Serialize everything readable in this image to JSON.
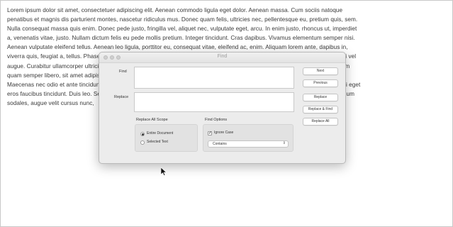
{
  "document": {
    "lines": [
      "Lorem ipsum dolor sit amet, consectetuer adipiscing elit. Aenean commodo ligula eget dolor. Aenean massa. Cum sociis natoque",
      "penatibus et magnis dis parturient montes, nascetur ridiculus mus. Donec quam felis, ultricies nec, pellentesque eu, pretium quis, sem.",
      "Nulla consequat massa quis enim. Donec pede justo, fringilla vel, aliquet nec, vulputate eget, arcu. In enim justo, rhoncus ut, imperdiet",
      "a, venenatis vitae, justo. Nullam dictum felis eu pede mollis pretium. Integer tincidunt. Cras dapibus. Vivamus elementum semper nisi.",
      "Aenean vulputate eleifend tellus. Aenean leo ligula, porttitor eu, consequat vitae, eleifend ac, enim. Aliquam lorem ante, dapibus in,",
      "viverra quis, feugiat a, tellus. Phasellus viverra nulla ut metus varius laoreet. Quisque rutrum. Aenean imperdiet. Etiam ultricies nisi vel",
      "augue. Curabitur ullamcorper ultricies nisi. Nam eget dui. Etiam rhoncus. Maecenas tempus, tellus eget condimentum rhoncus, sem",
      "quam semper libero, sit amet adipiscing sem neque sed ipsum. Nam quam nunc, blandit vel, luctus pulvinar, hendrerit id, lorem.",
      "Maecenas nec odio et ante tincidunt tempus. Donec vitae sapien ut libero venenatis faucibus. Nullam quis ante. Etiam sit amet orci eget",
      "eros faucibus tincidunt. Duis leo. Sed fringilla mauris sit amet nibh. Donec sodales sagittis magna. Sed consequat, leo eget bibendum",
      "sodales, augue velit cursus nunc,"
    ]
  },
  "find_panel": {
    "title": "Find",
    "find_label": "Find",
    "find_value": "",
    "replace_label": "Replace",
    "replace_value": "",
    "buttons": {
      "next": "Next",
      "previous": "Previous",
      "replace": "Replace",
      "replace_and_find": "Replace & Find",
      "replace_all": "Replace All"
    },
    "replace_all_scope": {
      "label": "Replace All Scope",
      "options": [
        "Entire Document",
        "Selected Text"
      ],
      "selected": "Entire Document"
    },
    "find_options": {
      "label": "Find Options",
      "ignore_case_label": "Ignore Case",
      "ignore_case_checked": true,
      "match_mode": "Contains"
    }
  }
}
